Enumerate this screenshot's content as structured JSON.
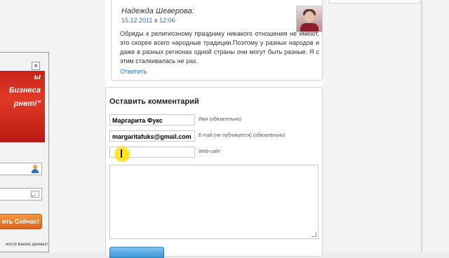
{
  "comment": {
    "author": "Надежда Шеверова:",
    "date": "15.12.2011 в 12:06",
    "text": "Обряды к религиозному празднику никакого отношения не имеют, это скорее всего народные традиции.Поэтому у разных народов и даже в разных регионах одной страны они могут быть разные. Я с этим сталкивалась не раз.",
    "reply_label": "Ответить"
  },
  "form": {
    "title": "Оставить комментарий",
    "name_value": "Маргарита Фукс",
    "name_label": "Имя (обязательно)",
    "email_value": "margaritafuks@gmail.com",
    "email_label": "E-mail (не публикуется) (обязательно)",
    "website_value": "",
    "website_label": "Web-сайт",
    "comment_value": ""
  },
  "popup": {
    "close_label": "×",
    "banner_lines": [
      "ы",
      "Бизнеса",
      "рнет!\""
    ],
    "cta_label": "ить Сейчас!",
    "note": "ности Ваших данных!"
  },
  "colors": {
    "link": "#2a6ebb",
    "popup_red": "#c8241b",
    "cta_orange": "#e0631a",
    "submit_blue": "#3d95d6",
    "cursor_highlight": "#ffdc00"
  }
}
